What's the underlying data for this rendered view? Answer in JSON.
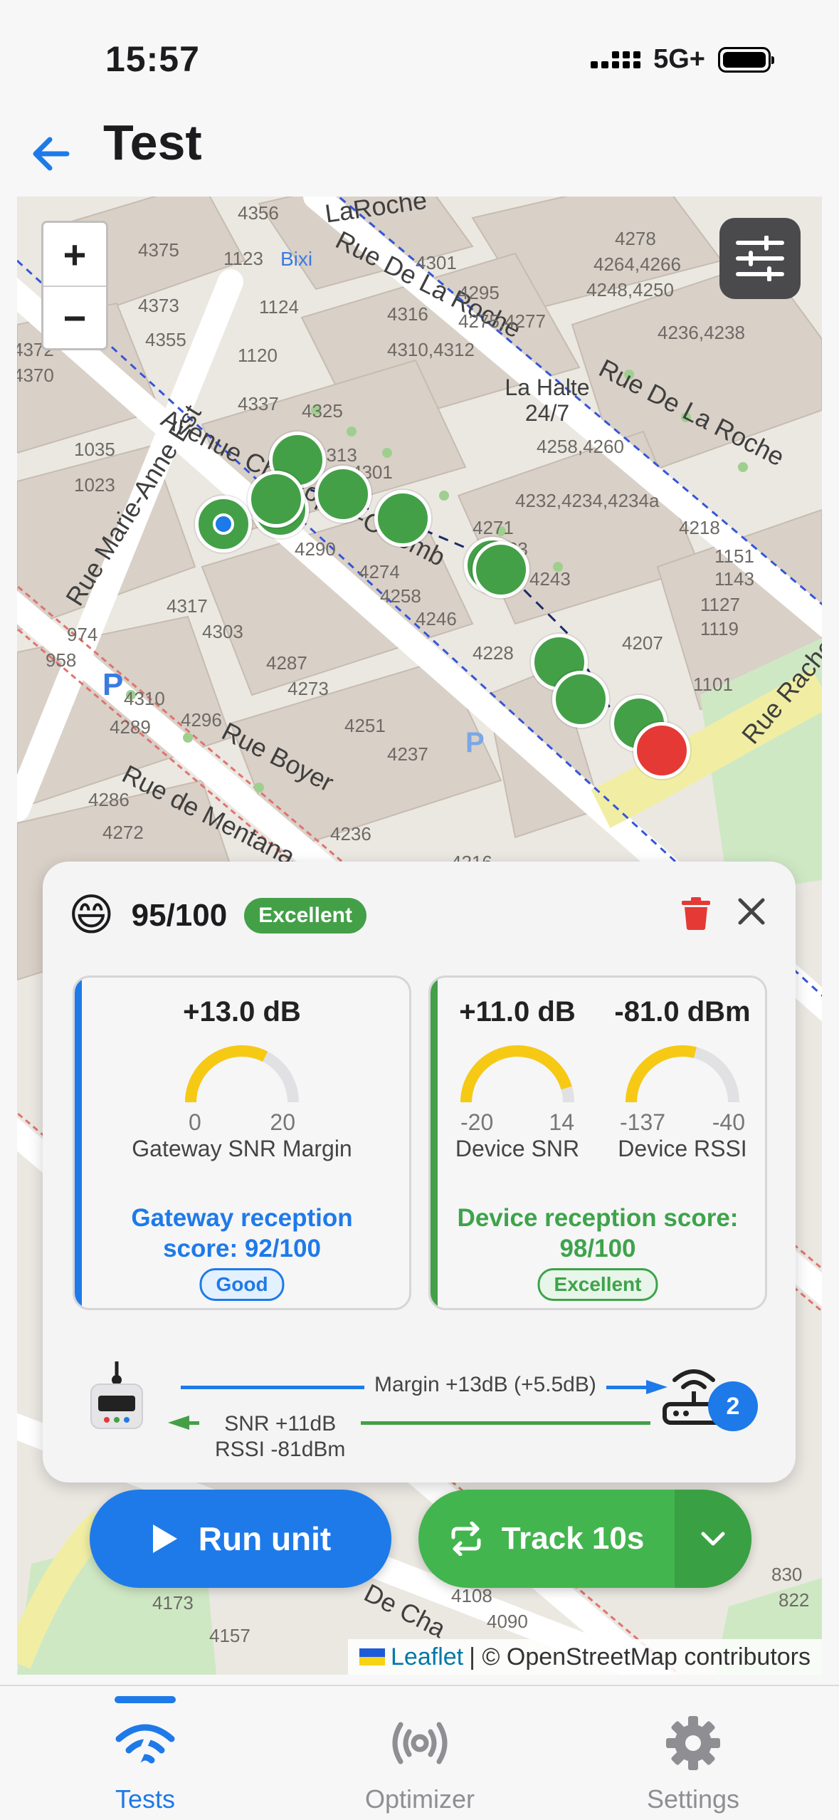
{
  "status": {
    "time": "15:57",
    "network": "5G+"
  },
  "header": {
    "title": "Test"
  },
  "map": {
    "zoom_in": "+",
    "zoom_out": "−",
    "streets": [
      "LaRoche",
      "Rue De La Roche",
      "Rue De La Roche",
      "Avenue Christophe-Colomb",
      "Rue Marie-Anne Est",
      "Rue Boyer",
      "Rue de Mentana",
      "Rue Rachel Est",
      "De Cha",
      "La Halte 24/7",
      "Bixi"
    ],
    "numbers": [
      "4356",
      "4375",
      "1123",
      "4373",
      "1124",
      "4355",
      "1120",
      "4337",
      "4325",
      "4316",
      "4301",
      "4310,4312",
      "4295",
      "4275,4277",
      "4278",
      "4264,4266",
      "4248,4250",
      "4236,4238",
      "4313",
      "4301",
      "4258,4260",
      "4232,4234,4234a",
      "4218",
      "1035",
      "1023",
      "4271",
      "4263",
      "4243",
      "1151",
      "1143",
      "1127",
      "1119",
      "4290",
      "4274",
      "4258",
      "4246",
      "4228",
      "4207",
      "1101",
      "4317",
      "4303",
      "974",
      "958",
      "4287",
      "4273",
      "4251",
      "4237",
      "4310",
      "4296",
      "4289",
      "4286",
      "4272",
      "4236",
      "4216",
      "4173",
      "4157",
      "4108",
      "4090",
      "830",
      "822",
      "4372",
      "4370"
    ],
    "attribution": {
      "leaflet": "Leaflet",
      "rest": "| © OpenStreetMap contributors"
    }
  },
  "result": {
    "emoji": "😄",
    "score": "95/100",
    "quality": "Excellent",
    "gateway": {
      "value": "+13.0 dB",
      "gauge_min": "0",
      "gauge_max": "20",
      "gauge_level": 0.65,
      "name": "Gateway SNR Margin",
      "score_line1": "Gateway reception",
      "score_line2": "score: 92/100",
      "quality": "Good"
    },
    "device": {
      "snr_value": "+11.0 dB",
      "snr_min": "-20",
      "snr_max": "14",
      "snr_level": 0.91,
      "snr_name": "Device SNR",
      "rssi_value": "-81.0 dBm",
      "rssi_min": "-137",
      "rssi_max": "-40",
      "rssi_level": 0.58,
      "rssi_name": "Device RSSI",
      "score_line1": "Device reception score:",
      "score_line2": "98/100",
      "quality": "Excellent"
    },
    "link": {
      "uplink": "Margin +13dB (+5.5dB)",
      "downlink_snr": "SNR +11dB",
      "downlink_rssi": "RSSI -81dBm",
      "gateway_count": "2"
    }
  },
  "actions": {
    "run": "Run unit",
    "track": "Track 10s"
  },
  "tabs": [
    {
      "label": "Tests",
      "active": true
    },
    {
      "label": "Optimizer",
      "active": false
    },
    {
      "label": "Settings",
      "active": false
    }
  ],
  "colors": {
    "accent": "#1e7ae8",
    "success": "#43a047",
    "danger": "#e53935",
    "gauge": "#f6c915"
  }
}
